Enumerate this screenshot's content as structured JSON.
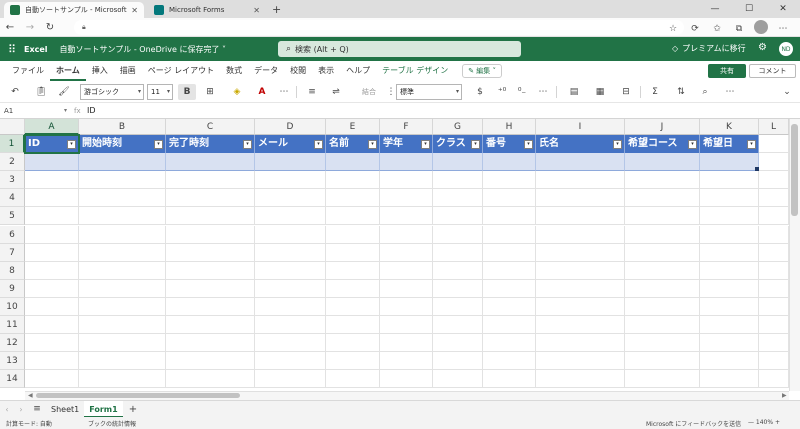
{
  "browser": {
    "tabs": [
      {
        "title": "自動ソートサンプル - Microsoft Exce",
        "active": true,
        "favicon_color": "#217346"
      },
      {
        "title": "Microsoft Forms",
        "active": false,
        "favicon_color": "#03787c"
      }
    ],
    "url": "",
    "new_tab": "+",
    "window_controls": [
      "—",
      "☐",
      "✕"
    ]
  },
  "excel_header": {
    "app_name": "Excel",
    "doc_name": "自動ソートサンプル - OneDrive に保存完了 ˅",
    "search_placeholder": "検索 (Alt + Q)",
    "premium": "プレミアムに移行",
    "user_initials": "ND"
  },
  "ribbon": {
    "tabs": [
      "ファイル",
      "ホーム",
      "挿入",
      "描画",
      "ページ レイアウト",
      "数式",
      "データ",
      "校閲",
      "表示",
      "ヘルプ",
      "テーブル デザイン"
    ],
    "active_tab": "ホーム",
    "edit_button": "✎ 編集 ˅",
    "share_button": "共有",
    "comment_button": "コメント"
  },
  "toolbar": {
    "font_name": "游ゴシック",
    "font_size": "11",
    "bold": "B",
    "merge": "結合",
    "number_format": "標準",
    "currency": "$"
  },
  "formula_bar": {
    "name_box": "A1",
    "fx": "fx",
    "value": "ID"
  },
  "grid": {
    "columns": [
      "A",
      "B",
      "C",
      "D",
      "E",
      "F",
      "G",
      "H",
      "I",
      "J",
      "K",
      "L"
    ],
    "selected_column": "A",
    "rows": [
      "1",
      "2",
      "3",
      "4",
      "5",
      "6",
      "7",
      "8",
      "9",
      "10",
      "11",
      "12",
      "13",
      "14"
    ],
    "selected_row": "1",
    "table_headers": [
      "ID",
      "開始時刻",
      "完了時刻",
      "メール",
      "名前",
      "学年",
      "クラス",
      "番号",
      "氏名",
      "希望コース",
      "希望日"
    ],
    "filter_glyph": "▾",
    "table_header_color": "#4472c4",
    "table_row_color": "#d9e1f2"
  },
  "sheets": {
    "tabs": [
      "Sheet1",
      "Form1"
    ],
    "active": "Form1",
    "add": "+"
  },
  "status": {
    "calc_mode": "計算モード: 自動",
    "workbook_stats": "ブックの統計情報",
    "feedback": "Microsoft にフィードバックを送信",
    "zoom": "140%"
  }
}
